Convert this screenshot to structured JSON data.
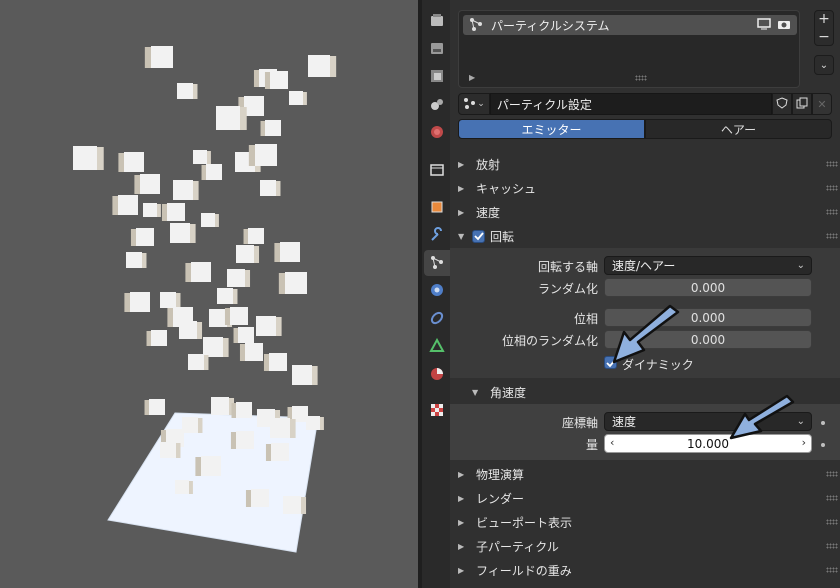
{
  "particle_system": {
    "list_item": "パーティクルシステム",
    "settings_name": "パーティクル設定",
    "tabs": [
      "エミッター",
      "ヘアー"
    ],
    "add_button": "+",
    "remove_button": "−"
  },
  "sections": {
    "emission": "放射",
    "cache": "キャッシュ",
    "velocity": "速度",
    "rotation": "回転",
    "physics": "物理演算",
    "render": "レンダー",
    "viewport_display": "ビューポート表示",
    "children": "子パーティクル",
    "field_weights": "フィールドの重み"
  },
  "rotation": {
    "axis_label": "回転する軸",
    "axis_value": "速度/ヘアー",
    "randomize_label": "ランダム化",
    "randomize_value": "0.000",
    "phase_label": "位相",
    "phase_value": "0.000",
    "phase_random_label": "位相のランダム化",
    "phase_random_value": "0.000",
    "dynamic_label": "ダイナミック"
  },
  "angular_velocity": {
    "title": "角速度",
    "axis_label": "座標軸",
    "axis_value": "速度",
    "amount_label": "量",
    "amount_value": "10.000"
  },
  "colors": {
    "accent": "#4772b3",
    "viewport_bg": "#5a5a5a",
    "annotation_arrow": "#8fb0de"
  },
  "icons": [
    "render-icon",
    "output-icon",
    "view-layer-icon",
    "scene-icon",
    "world-icon",
    "collection-icon",
    "object-icon",
    "modifier-icon",
    "particles-icon",
    "physics-icon",
    "constraints-icon",
    "data-icon",
    "material-icon",
    "texture-icon"
  ]
}
